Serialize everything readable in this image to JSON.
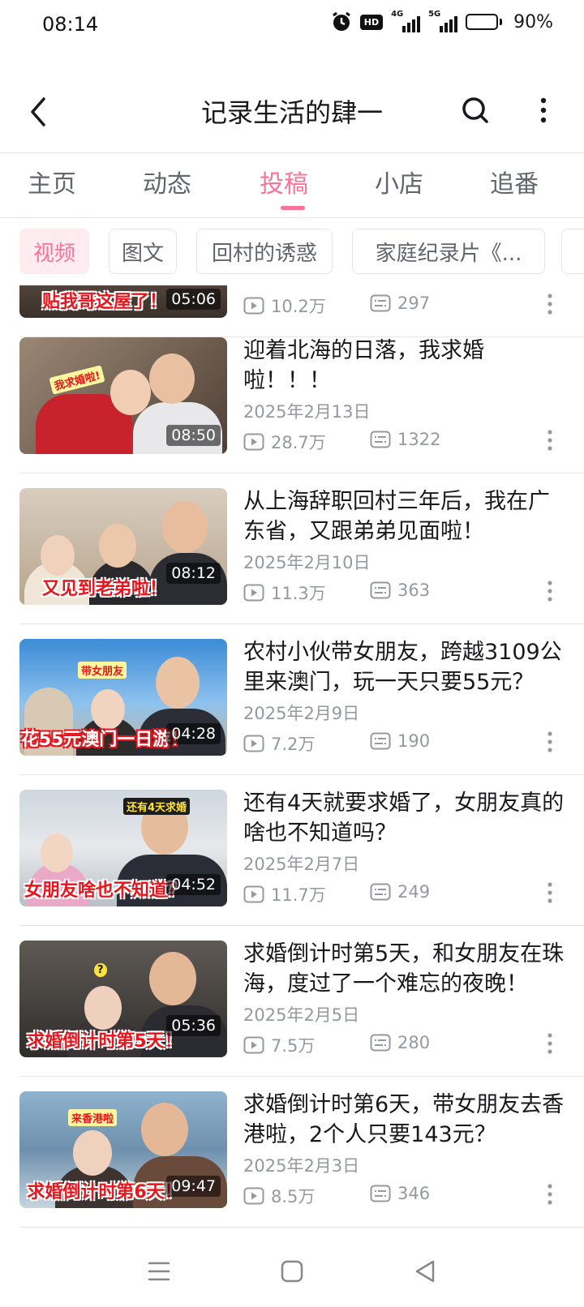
{
  "status": {
    "time": "08:14",
    "hd": "HD",
    "net1": "4G",
    "net2": "5G",
    "battery_level": 0.9,
    "battery_text": "90%"
  },
  "header": {
    "title": "记录生活的肆一"
  },
  "tabs": [
    {
      "label": "主页",
      "active": false
    },
    {
      "label": "动态",
      "active": false
    },
    {
      "label": "投稿",
      "active": true
    },
    {
      "label": "小店",
      "active": false
    },
    {
      "label": "追番",
      "active": false
    }
  ],
  "chips": [
    {
      "label": "视频",
      "active": true
    },
    {
      "label": "图文",
      "active": false
    },
    {
      "label": "回村的诱惑",
      "active": false
    },
    {
      "label": "家庭纪录片《...",
      "active": false
    }
  ],
  "videos": [
    {
      "title": "",
      "date": "",
      "caption": "贴我哥这屋了！",
      "duration": "05:06",
      "views": "10.2万",
      "comments": "297",
      "tag": ""
    },
    {
      "title": "迎着北海的日落，我求婚啦！！！",
      "date": "2025年2月13日",
      "caption": "",
      "duration": "08:50",
      "views": "28.7万",
      "comments": "1322",
      "tag": "我求婚啦!"
    },
    {
      "title": "从上海辞职回村三年后，我在广东省，又跟弟弟见面啦！",
      "date": "2025年2月10日",
      "caption": "又见到老弟啦！",
      "duration": "08:12",
      "views": "11.3万",
      "comments": "363",
      "tag": ""
    },
    {
      "title": "农村小伙带女朋友，跨越3109公里来澳门，玩一天只要55元？",
      "date": "2025年2月9日",
      "caption": "花55元澳门一日游！",
      "duration": "04:28",
      "views": "7.2万",
      "comments": "190",
      "tag": "带女朋友"
    },
    {
      "title": "还有4天就要求婚了，女朋友真的啥也不知道吗？",
      "date": "2025年2月7日",
      "caption": "女朋友啥也不知道？",
      "duration": "04:52",
      "views": "11.7万",
      "comments": "249",
      "tag": "还有4天求婚"
    },
    {
      "title": "求婚倒计时第5天，和女朋友在珠海，度过了一个难忘的夜晚！",
      "date": "2025年2月5日",
      "caption": "求婚倒计时第5天！",
      "duration": "05:36",
      "views": "7.5万",
      "comments": "280",
      "tag": ""
    },
    {
      "title": "求婚倒计时第6天，带女朋友去香港啦，2个人只要143元？",
      "date": "2025年2月3日",
      "caption": "求婚倒计时第6天！",
      "duration": "09:47",
      "views": "8.5万",
      "comments": "346",
      "tag": "来香港啦"
    }
  ],
  "colors": {
    "accent": "#fb7299",
    "muted": "#9499a0",
    "text": "#18191c"
  }
}
